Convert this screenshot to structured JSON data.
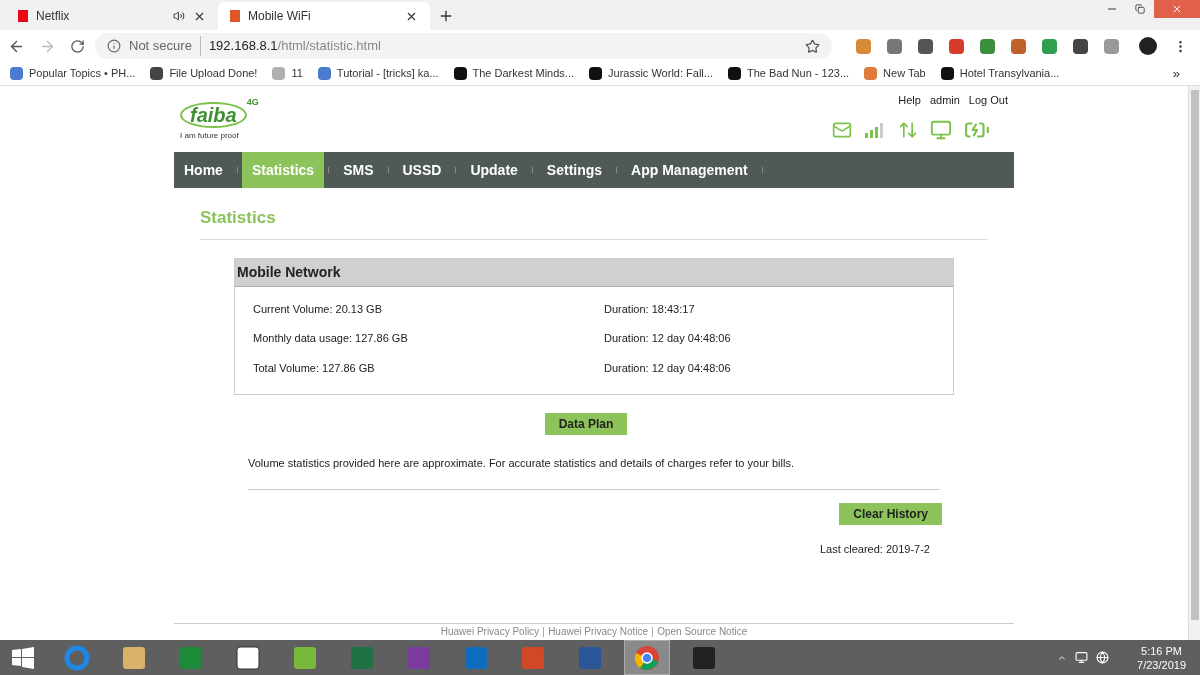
{
  "browser": {
    "tabs": [
      {
        "title": "Netflix",
        "selected": false,
        "audio": true,
        "color": "#e50914"
      },
      {
        "title": "Mobile WiFi",
        "selected": true,
        "audio": false,
        "color": "#e0542a"
      }
    ],
    "address": {
      "security": "Not secure",
      "host": "192.168.8.1",
      "path": "/html/statistic.html"
    },
    "bookmarks": [
      {
        "label": "Popular Topics • PH...",
        "color": "#4a7bd0"
      },
      {
        "label": "File Upload Done!",
        "color": "#444444"
      },
      {
        "label": "11",
        "color": "#b0b0b0"
      },
      {
        "label": "Tutorial - [tricks] ka...",
        "color": "#4a7bd0"
      },
      {
        "label": "The Darkest Minds...",
        "color": "#111111"
      },
      {
        "label": "Jurassic World: Fall...",
        "color": "#111111"
      },
      {
        "label": "The Bad Nun - 123...",
        "color": "#111111"
      },
      {
        "label": "New Tab",
        "color": "#e07a3a"
      },
      {
        "label": "Hotel Transylvania...",
        "color": "#111111"
      }
    ],
    "more": "»"
  },
  "router": {
    "header_links": [
      "Help",
      "admin",
      "Log Out"
    ],
    "logo": {
      "name": "faiba",
      "badge": "4G",
      "tagline": "I am future proof"
    },
    "nav": [
      {
        "label": "Home",
        "selected": false
      },
      {
        "label": "Statistics",
        "selected": true
      },
      {
        "label": "SMS",
        "selected": false
      },
      {
        "label": "USSD",
        "selected": false
      },
      {
        "label": "Update",
        "selected": false
      },
      {
        "label": "Settings",
        "selected": false
      },
      {
        "label": "App Management",
        "selected": false
      }
    ],
    "title": "Statistics",
    "panel": {
      "title": "Mobile Network",
      "rows": [
        {
          "volume": "Current Volume: 20.13 GB",
          "duration": "Duration: 18:43:17"
        },
        {
          "volume": "Monthly data usage: 127.86 GB",
          "duration": "Duration: 12 day 04:48:06"
        },
        {
          "volume": "Total Volume: 127.86 GB",
          "duration": "Duration: 12 day 04:48:06"
        }
      ]
    },
    "data_plan_button": "Data Plan",
    "note": "Volume statistics provided here are approximate. For accurate statistics and details of charges refer to your bills.",
    "clear_button": "Clear History",
    "last_cleared": "Last cleared: 2019-7-2",
    "footer_links": [
      "Huawei Privacy Policy",
      "Huawei Privacy Notice",
      "Open Source Notice"
    ]
  },
  "taskbar": {
    "apps": [
      {
        "kind": "ie",
        "selected": false
      },
      {
        "kind": "files",
        "selected": false
      },
      {
        "kind": "store",
        "selected": false
      },
      {
        "kind": "amazon",
        "selected": false
      },
      {
        "kind": "torrent",
        "selected": false
      },
      {
        "kind": "excel",
        "selected": false
      },
      {
        "kind": "onenote",
        "selected": false
      },
      {
        "kind": "outlook",
        "selected": false
      },
      {
        "kind": "powerpoint",
        "selected": false
      },
      {
        "kind": "word",
        "selected": false
      },
      {
        "kind": "chrome",
        "selected": true
      },
      {
        "kind": "game",
        "selected": false
      }
    ],
    "time": "5:16 PM",
    "date": "7/23/2019"
  }
}
